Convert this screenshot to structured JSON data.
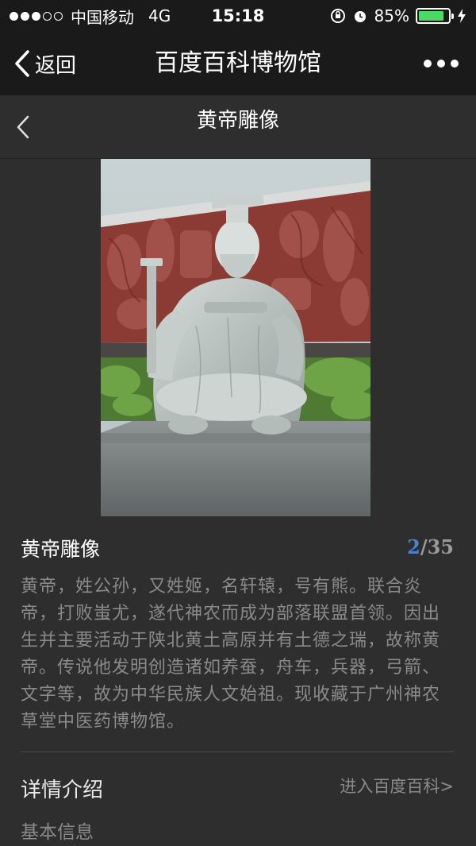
{
  "status_bar": {
    "carrier": "中国移动",
    "network": "4G",
    "time": "15:18",
    "battery": "85%",
    "battery_level": 0.85,
    "signal_bars": 3,
    "signal_total": 5,
    "icons": [
      "rotation-lock-icon",
      "alarm-icon",
      "battery-icon",
      "charging-icon"
    ]
  },
  "nav": {
    "back_label": "返回",
    "title": "百度百科博物馆",
    "more_icon": "more-dots-icon"
  },
  "page": {
    "header_title": "黄帝雕像"
  },
  "item": {
    "title": "黄帝雕像",
    "index": "2",
    "separator": "/",
    "total": "35",
    "description": "黄帝，姓公孙，又姓姬，名轩辕，号有熊。联合炎帝，打败蚩尤，遂代神农而成为部落联盟首领。因出生并主要活动于陕北黄土高原并有土德之瑞，故称黄帝。传说他发明创造诸如养蚕，舟车，兵器，弓箭、文字等，故为中华民族人文始祖。现收藏于广州神农草堂中医药博物馆。"
  },
  "details": {
    "section_title": "详情介绍",
    "link_label": "进入百度百科>",
    "basic_info_label": "基本信息"
  },
  "colors": {
    "accent": "#4a7fd6",
    "battery": "#4cd964",
    "bar_bg": "#1a1a1a",
    "panel_bg": "#2e2e2e"
  }
}
